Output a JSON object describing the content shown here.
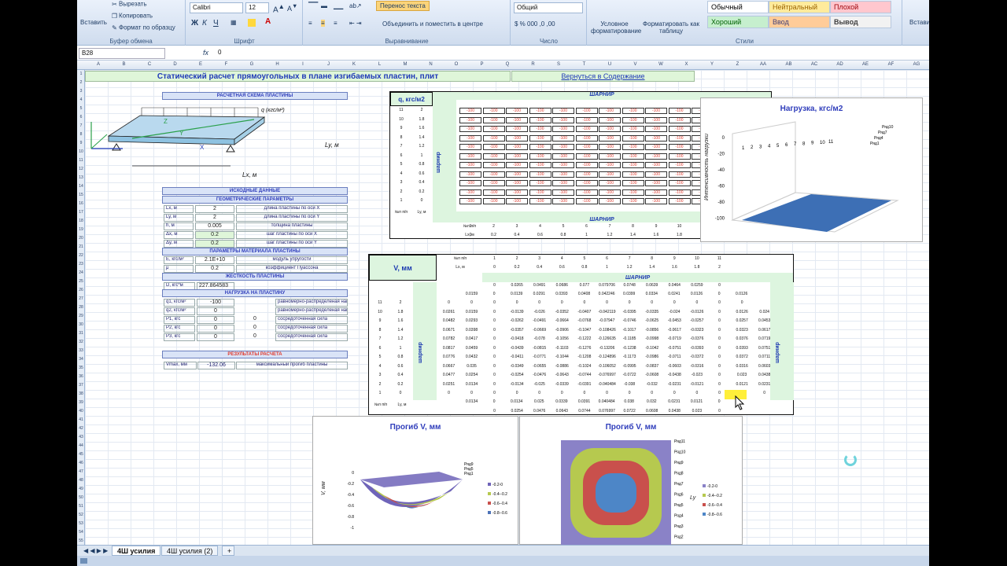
{
  "ribbon": {
    "paste": "Вставить",
    "cut": "Вырезать",
    "copy": "Копировать",
    "format_painter": "Формат по образцу",
    "clipboard": "Буфер обмена",
    "font_name": "Calibri",
    "font_size": "12",
    "bold": "Ж",
    "italic": "К",
    "underline": "Ч",
    "font_group": "Шрифт",
    "wrap": "Перенос текста",
    "merge": "Объединить и поместить в центре",
    "align_group": "Выравнивание",
    "number_format": "Общий",
    "number_group": "Число",
    "cond_format": "Условное форматирование",
    "table_format": "Форматировать как таблицу",
    "styles": [
      "Обычный",
      "Нейтральный",
      "Плохой",
      "Хороший",
      "Ввод",
      "Вывод"
    ],
    "styles_group": "Стили",
    "insert": "Вставить"
  },
  "formula": {
    "name_box": "B28",
    "fx": "fx",
    "value": "0"
  },
  "columns": [
    "A",
    "B",
    "C",
    "D",
    "E",
    "F",
    "G",
    "H",
    "I",
    "J",
    "K",
    "L",
    "M",
    "N",
    "O",
    "P",
    "Q",
    "R",
    "S",
    "T",
    "U",
    "V",
    "W",
    "X",
    "Y",
    "Z",
    "AA",
    "AB",
    "AC",
    "AD",
    "AE",
    "AF",
    "AG"
  ],
  "title": "Статический расчет прямоугольных в плане изгибаемых пластин, плит",
  "back_link": "Вернуться в Содержание",
  "left": {
    "scheme_hdr": "РАСЧЕТНАЯ СХЕМА ПЛАСТИНЫ",
    "scheme_q": "q (кгс/м²)",
    "scheme_lx": "Lx, м",
    "scheme_ly": "Ly, м",
    "axis_x": "X",
    "axis_y": "Y",
    "axis_z": "Z",
    "input_hdr": "ИСХОДНЫЕ ДАННЫЕ",
    "geom_hdr": "ГЕОМЕТРИЧЕСКИЕ ПАРАМЕТРЫ",
    "geom": [
      [
        "Lx, м",
        "2",
        "длина пластины по оси X"
      ],
      [
        "Ly, м",
        "2",
        "длина пластины по оси Y"
      ],
      [
        "h, м",
        "0.005",
        "толщина пластины"
      ],
      [
        "Δx, м",
        "0.2",
        "шаг пластины по оси X"
      ],
      [
        "Δy, м",
        "0.2",
        "шаг пластины по оси Y"
      ]
    ],
    "mat_hdr": "ПАРАМЕТРЫ МАТЕРИАЛА ПЛАСТИНЫ",
    "mat": [
      [
        "E, кгс/м²",
        "2.1E+10",
        "модуль упругости"
      ],
      [
        "μ",
        "0.2",
        "коэффициент Пуассона"
      ]
    ],
    "stiff_hdr": "ЖЕСТКОСТЬ ПЛАСТИНЫ",
    "stiff": [
      "D, кгс*м",
      "227.864583"
    ],
    "load_hdr": "НАГРУЗКА НА ПЛАСТИНУ",
    "loads": [
      [
        "q1, кгс/м²",
        "-100",
        "",
        "равномерно-распределеная нагрузка"
      ],
      [
        "q2, кгс/м²",
        "0",
        "",
        "равномерно-распределеная нагрузка"
      ],
      [
        "P1, кгс",
        "0",
        "0",
        "сосредоточенная сила"
      ],
      [
        "P2, кгс",
        "0",
        "0",
        "сосредоточенная сила"
      ],
      [
        "P3, кгс",
        "0",
        "0",
        "сосредоточенная сила"
      ]
    ],
    "res_hdr": "РЕЗУЛЬТАТЫ РАСЧЕТА",
    "res": [
      "Vmax, мм",
      "-132.06",
      "максимальный прогиб пластины"
    ]
  },
  "q_table": {
    "head": "q, кгс/м2",
    "hinge": "шарнир",
    "rows": [
      [
        "11",
        "2"
      ],
      [
        "10",
        "1.8"
      ],
      [
        "9",
        "1.6"
      ],
      [
        "8",
        "1.4"
      ],
      [
        "7",
        "1.2"
      ],
      [
        "6",
        "1"
      ],
      [
        "5",
        "0.8"
      ],
      [
        "4",
        "0.6"
      ],
      [
        "3",
        "0.4"
      ],
      [
        "2",
        "0.2"
      ],
      [
        "1",
        "0"
      ]
    ],
    "load_value": "-100",
    "foot_labels": [
      "№п п/п",
      "Ly, м"
    ],
    "np": "№п п/п",
    "lx": "Lx, м",
    "cols": [
      "1",
      "2",
      "3",
      "4",
      "5",
      "6",
      "7",
      "8",
      "9",
      "10",
      "11"
    ],
    "lx_vals": [
      "0",
      "0.2",
      "0.4",
      "0.6",
      "0.8",
      "1",
      "1.2",
      "1.4",
      "1.6",
      "1.8",
      "2"
    ]
  },
  "v_table": {
    "head": "V, мм",
    "hinge": "шарнир",
    "np": "№п п/п",
    "lx": "Lx, м",
    "ly": "Ly, м",
    "cols": [
      "1",
      "2",
      "3",
      "4",
      "5",
      "6",
      "7",
      "8",
      "9",
      "10",
      "11"
    ],
    "lx_vals": [
      "0",
      "0.2",
      "0.4",
      "0.6",
      "0.8",
      "1",
      "1.2",
      "1.4",
      "1.6",
      "1.8",
      "2"
    ],
    "top1": [
      "0",
      "0.0265",
      "0.0491",
      "0.0686",
      "0.077",
      "0.079706",
      "0.0748",
      "0.0639",
      "0.0464",
      "0.0259",
      "0"
    ],
    "top2": [
      "0.0159",
      "0",
      "0.0139",
      "0.0291",
      "0.0393",
      "0.0408",
      "0.042246",
      "0.0399",
      "0.0334",
      "0.0241",
      "0.0126",
      "0",
      "0.0126"
    ],
    "rows": [
      [
        "11",
        "2",
        "0",
        "0",
        "0",
        "0",
        "0",
        "0",
        "0",
        "0",
        "0",
        "0",
        "0",
        "0",
        "0",
        "0"
      ],
      [
        "10",
        "1.8",
        "0.0261",
        "0.0159",
        "0",
        "-0.0139",
        "-0.026",
        "-0.0352",
        "-0.0407",
        "-0.042119",
        "-0.0395",
        "-0.0335",
        "-0.024",
        "-0.0126",
        "0",
        "0.0126",
        "0.024"
      ],
      [
        "9",
        "1.6",
        "0.0482",
        "0.0293",
        "0",
        "-0.0262",
        "-0.0491",
        "-0.0664",
        "-0.0768",
        "-0.07947",
        "-0.0746",
        "-0.0625",
        "-0.0453",
        "-0.0257",
        "0",
        "0.0257",
        "0.0453"
      ],
      [
        "8",
        "1.4",
        "0.0671",
        "0.0398",
        "0",
        "-0.0357",
        "-0.0669",
        "-0.0906",
        "-0.1047",
        "-0.108426",
        "-0.1017",
        "-0.0856",
        "-0.0617",
        "-0.0323",
        "0",
        "0.0323",
        "0.0617"
      ],
      [
        "7",
        "1.2",
        "0.0782",
        "0.0417",
        "0",
        "-0.0418",
        "-0.078",
        "-0.1056",
        "-0.1222",
        "-0.126635",
        "-0.1185",
        "-0.0998",
        "-0.0719",
        "-0.0376",
        "0",
        "0.0376",
        "0.0719"
      ],
      [
        "6",
        "1",
        "0.0817",
        "0.0459",
        "0",
        "-0.0439",
        "-0.0815",
        "-0.1103",
        "-0.1276",
        "-0.13206",
        "-0.1238",
        "-0.1042",
        "-0.0751",
        "-0.0393",
        "0",
        "0.0393",
        "0.0751"
      ],
      [
        "5",
        "0.8",
        "0.0776",
        "0.0432",
        "0",
        "-0.0411",
        "-0.0771",
        "-0.1044",
        "-0.1208",
        "-0.124896",
        "-0.1173",
        "-0.0986",
        "-0.0711",
        "-0.0372",
        "0",
        "0.0372",
        "0.0711"
      ],
      [
        "4",
        "0.6",
        "0.0667",
        "0.035",
        "0",
        "-0.0349",
        "-0.0655",
        "-0.0886",
        "-0.1024",
        "-0.106052",
        "-0.0995",
        "-0.0837",
        "-0.0603",
        "-0.0316",
        "0",
        "0.0316",
        "0.0603"
      ],
      [
        "3",
        "0.4",
        "0.0477",
        "0.0254",
        "0",
        "-0.0254",
        "-0.0476",
        "-0.0643",
        "-0.0744",
        "-0.076997",
        "-0.0722",
        "-0.0608",
        "-0.0438",
        "-0.023",
        "0",
        "0.023",
        "0.0438"
      ],
      [
        "2",
        "0.2",
        "0.0251",
        "0.0134",
        "0",
        "-0.0134",
        "-0.025",
        "-0.0339",
        "-0.0391",
        "-0.040484",
        "-0.038",
        "-0.032",
        "-0.0231",
        "-0.0121",
        "0",
        "0.0121",
        "0.0231"
      ],
      [
        "1",
        "0",
        "0",
        "0",
        "0",
        "0",
        "0",
        "0",
        "0",
        "0",
        "0",
        "0",
        "0",
        "0",
        "0",
        "0",
        "0"
      ]
    ],
    "bot1": [
      "0.0134",
      "0",
      "0.0134",
      "0.025",
      "0.0339",
      "0.0391",
      "0.040484",
      "0.038",
      "0.032",
      "0.0231",
      "0.0121",
      "0"
    ],
    "bot2": [
      "0",
      "0.0254",
      "0.0476",
      "0.0643",
      "0.0744",
      "0.076997",
      "0.0722",
      "0.0608",
      "0.0438",
      "0.023",
      "0"
    ]
  },
  "chart_load": {
    "title": "Нагрузка, кгс/м2",
    "ylabel": "Интенсивность нагрузки",
    "yticks": [
      "0",
      "-20",
      "-40",
      "-60",
      "-80",
      "-100"
    ],
    "xticks": [
      "1",
      "2",
      "3",
      "4",
      "5",
      "6",
      "7",
      "8",
      "9",
      "10",
      "11"
    ],
    "series": [
      "Ряд10",
      "Ряд7",
      "Ряд4",
      "Ряд1"
    ],
    "surface_color": "#3d6fb5"
  },
  "chart_v3d": {
    "title": "Прогиб V, мм",
    "ylabel": "V, мм",
    "yticks": [
      "0",
      "-0.2",
      "-0.4",
      "-0.6",
      "-0.8",
      "-1"
    ],
    "series": [
      "Ряд9",
      "Ряд5",
      "Ряд1"
    ],
    "legend": [
      "-0.2-0",
      "-0.4--0.2",
      "-0.6--0.4",
      "-0.8--0.6"
    ],
    "colors": [
      "#6f64b9",
      "#b6c94f",
      "#c9504c",
      "#4d73b8"
    ]
  },
  "chart_v2d": {
    "title": "Прогиб V, мм",
    "ylabel": "Ly",
    "rows": [
      "Ряд11",
      "Ряд10",
      "Ряд9",
      "Ряд8",
      "Ряд7",
      "Ряд6",
      "Ряд5",
      "Ряд4",
      "Ряд3",
      "Ряд2"
    ],
    "legend": [
      "-0.2-0",
      "-0.4--0.2",
      "-0.6--0.4",
      "-0.8--0.6"
    ],
    "colors": [
      "#8a82c7",
      "#b6c94f",
      "#c9504c",
      "#4d86c7"
    ]
  },
  "tabs": [
    "4Ш усилия",
    "4Ш усилия (2)"
  ]
}
